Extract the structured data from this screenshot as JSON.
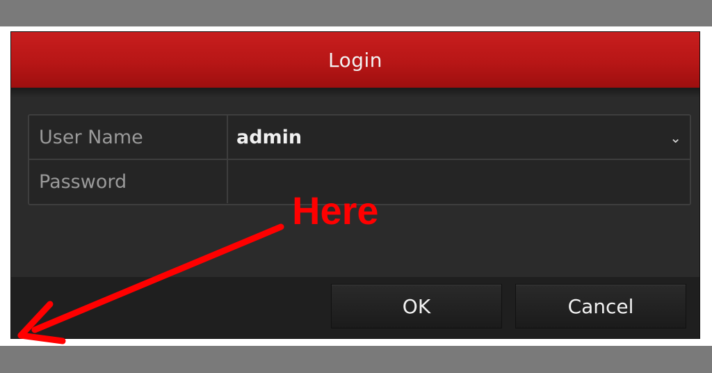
{
  "dialog": {
    "title": "Login",
    "fields": [
      {
        "label": "User Name",
        "value": "admin",
        "type": "dropdown"
      },
      {
        "label": "Password",
        "value": "",
        "type": "password"
      }
    ],
    "buttons": {
      "ok_label": "OK",
      "cancel_label": "Cancel"
    },
    "icons": {
      "dropdown": "chevron-down-icon"
    }
  },
  "annotation": {
    "text": "Here",
    "color": "#ff0000"
  },
  "colors": {
    "title_bar": "#b71616",
    "dialog_bg": "#2b2b2b"
  }
}
